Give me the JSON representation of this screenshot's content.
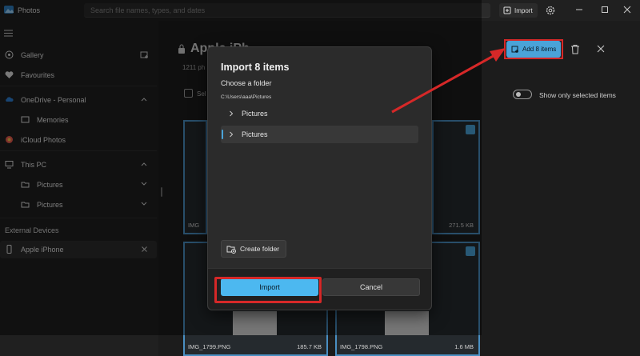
{
  "app": {
    "title": "Photos"
  },
  "search": {
    "placeholder": "Search file names, types, and dates"
  },
  "titlebar": {
    "import_label": "Import"
  },
  "sidebar": {
    "gallery": "Gallery",
    "favourites": "Favourites",
    "onedrive": "OneDrive - Personal",
    "memories": "Memories",
    "icloud": "iCloud Photos",
    "this_pc": "This PC",
    "pictures_1": "Pictures",
    "pictures_2": "Pictures",
    "external_devices": "External Devices",
    "device": "Apple iPhone"
  },
  "main": {
    "album_title": "Apple iPh",
    "album_count": "1211 ph",
    "select_label": "Sel",
    "add_button": "Add 8 items",
    "toggle_label": "Show only selected items"
  },
  "thumbnails": [
    {
      "name": "IMG",
      "size": ""
    },
    {
      "name": "",
      "size": "271.5 KB"
    },
    {
      "name": "IMG_1799.PNG",
      "size": "185.7 KB"
    },
    {
      "name": "IMG_1798.PNG",
      "size": "1.6 MB"
    }
  ],
  "dialog": {
    "title": "Import 8 items",
    "subtitle": "Choose a folder",
    "path": "C:\\Users\\aaa\\Pictures",
    "tree": [
      {
        "label": "Pictures"
      },
      {
        "label": "Pictures"
      }
    ],
    "create_folder": "Create folder",
    "import_button": "Import",
    "cancel_button": "Cancel"
  },
  "colors": {
    "accent": "#4cb8f0",
    "annotation": "#d62828"
  }
}
